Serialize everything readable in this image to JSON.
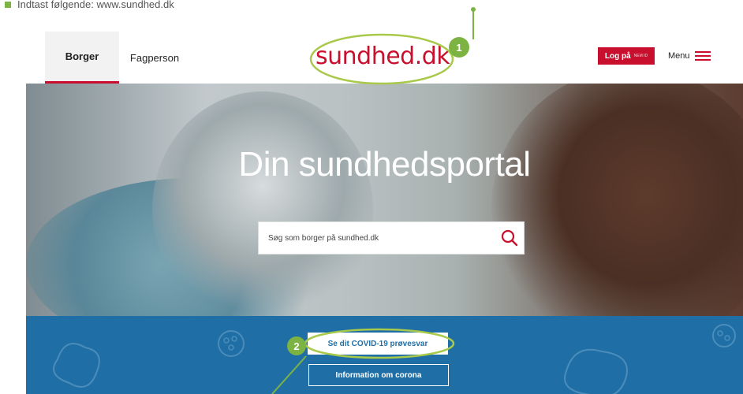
{
  "caption": {
    "text": "Indtast følgende: www.sundhed.dk"
  },
  "header": {
    "tabs": [
      {
        "label": "Borger",
        "active": true
      },
      {
        "label": "Fagperson",
        "active": false
      }
    ],
    "logo": {
      "text_main": "sundhed",
      "text_dot": ".",
      "text_tld": "dk"
    },
    "login": {
      "label": "Log på",
      "sub": "NEM ID"
    },
    "menu": {
      "label": "Menu",
      "icon": "hamburger-icon"
    }
  },
  "hero": {
    "title": "Din sundhedsportal",
    "search": {
      "placeholder": "Søg som borger på sundhed.dk",
      "icon": "search-icon"
    }
  },
  "actions": {
    "covid_button": "Se dit COVID-19 prøvesvar",
    "info_button": "Information om corona"
  },
  "annotations": [
    {
      "number": "1"
    },
    {
      "number": "2"
    }
  ],
  "colors": {
    "brand_red": "#c8102e",
    "blue_band": "#1f6fa6",
    "annotation_green": "#7cb342"
  }
}
